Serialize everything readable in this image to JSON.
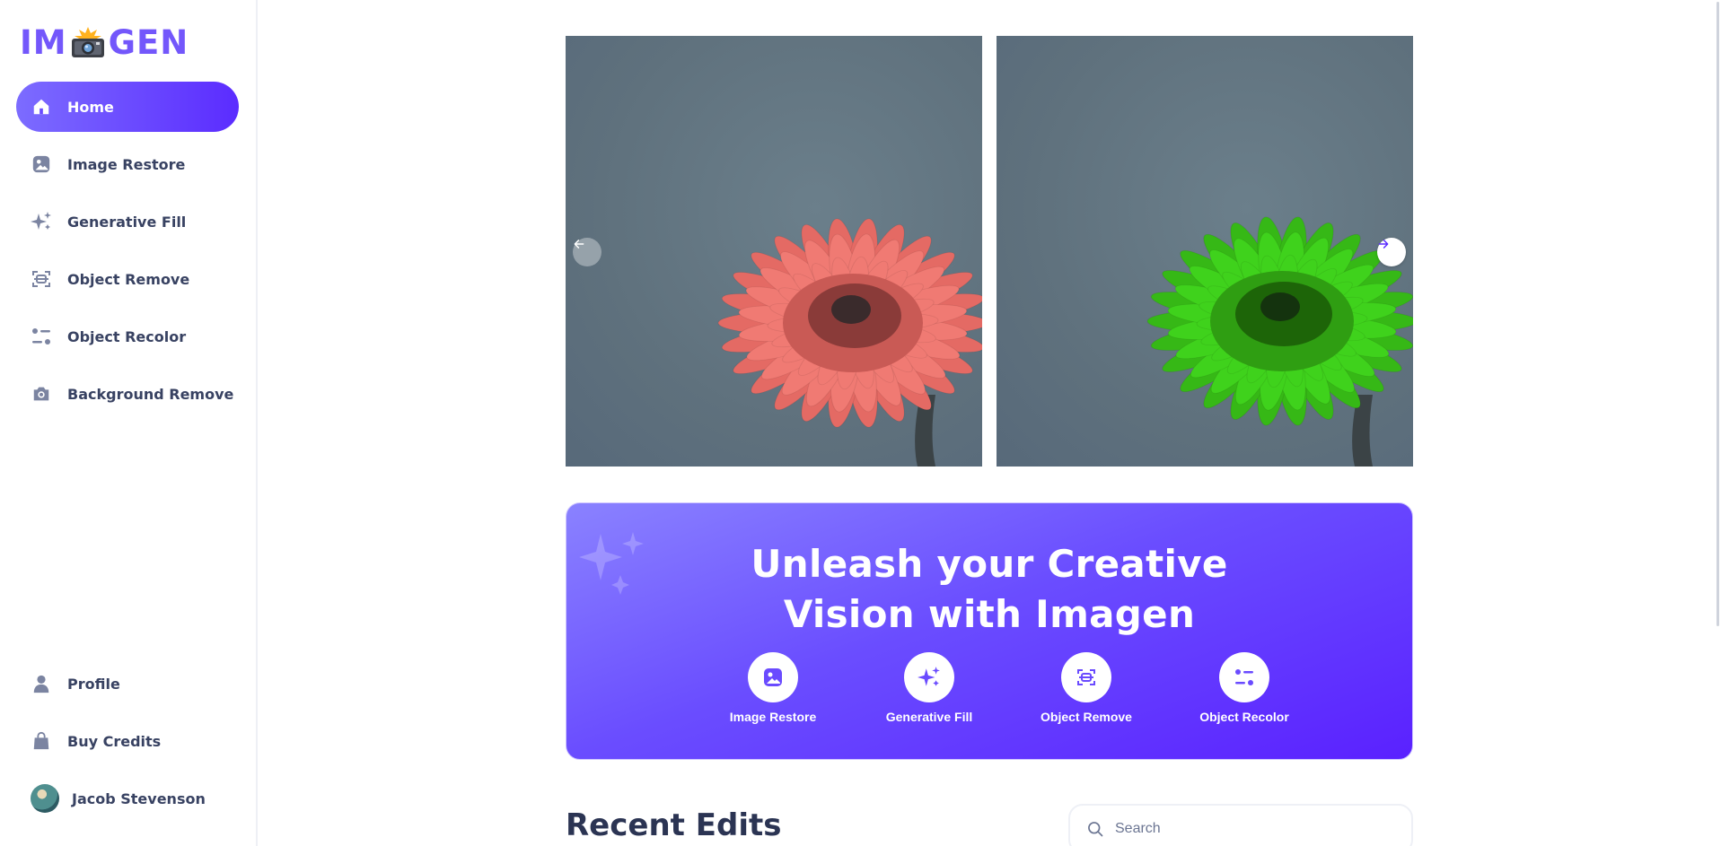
{
  "app": {
    "logo_left": "IM",
    "logo_right": "GEN",
    "brand_color": "#7357fb"
  },
  "sidebar": {
    "items": [
      {
        "label": "Home",
        "icon": "home-icon",
        "active": true
      },
      {
        "label": "Image Restore",
        "icon": "image-icon"
      },
      {
        "label": "Generative Fill",
        "icon": "sparkles-icon"
      },
      {
        "label": "Object Remove",
        "icon": "scan-icon"
      },
      {
        "label": "Object Recolor",
        "icon": "filter-icon"
      },
      {
        "label": "Background Remove",
        "icon": "camera-icon"
      }
    ],
    "bottom": [
      {
        "label": "Profile",
        "icon": "user-icon"
      },
      {
        "label": "Buy Credits",
        "icon": "bag-icon"
      }
    ],
    "user_name": "Jacob Stevenson"
  },
  "carousel": {
    "before_color": "#f07a73",
    "after_color": "#3fd21c"
  },
  "banner": {
    "title_line1": "Unleash your Creative",
    "title_line2": "Vision with Imagen",
    "features": [
      {
        "label": "Image Restore",
        "icon": "image-icon"
      },
      {
        "label": "Generative Fill",
        "icon": "sparkles-icon"
      },
      {
        "label": "Object Remove",
        "icon": "scan-icon"
      },
      {
        "label": "Object Recolor",
        "icon": "filter-icon"
      }
    ]
  },
  "recent": {
    "title": "Recent Edits",
    "search_placeholder": "Search"
  }
}
